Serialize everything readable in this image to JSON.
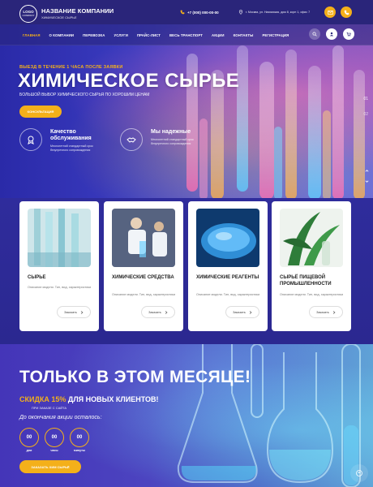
{
  "header": {
    "logo_line1": "LOGO",
    "logo_line2": "COMPANY",
    "company_name": "НАЗВАНИЕ КОМПАНИИ",
    "company_sub": "ХИМИЧЕСКОЕ СЫРЬЕ",
    "phone": "+7 (000) 000-00-00",
    "address": "г. Москва, ул. Нахимская, дом 8, корп 1, офис 7",
    "icons": [
      "phone-icon",
      "map-pin-icon",
      "mail-icon",
      "call-icon"
    ]
  },
  "nav": {
    "items": [
      {
        "label": "ГЛАВНАЯ",
        "active": true
      },
      {
        "label": "О КОМПАНИИ"
      },
      {
        "label": "ПЕРЕВОЗКА"
      },
      {
        "label": "УСЛУГИ"
      },
      {
        "label": "ПРАЙС-ЛИСТ"
      },
      {
        "label": "ВЕСЬ ТРАНСПОРТ"
      },
      {
        "label": "АКЦИИ"
      },
      {
        "label": "КОНТАКТЫ"
      },
      {
        "label": "РЕГИСТРАЦИЯ"
      }
    ],
    "icons": [
      "search-icon",
      "user-icon",
      "cart-icon"
    ]
  },
  "hero": {
    "tagline": "ВЫЕЗД В ТЕЧЕНИЕ 1 ЧАСА ПОСЛЕ ЗАЯВКИ",
    "title": "ХИМИЧЕСКОЕ СЫРЬЕ",
    "subtitle": "БОЛЬШОЙ ВЫБОР ХИМИЧЕСКОГО СЫРЬЯ ПО ХОРОШИМ ЦЕНАМ",
    "button": "КОНСУЛЬТАЦИЯ",
    "features": [
      {
        "title": "Качество обслуживания",
        "desc": "Многолетний стандартный срок безупречного сопровождения",
        "icon": "award-icon"
      },
      {
        "title": "Мы надежные",
        "desc": "Многолетний стандартный срок безупречного сопровождения",
        "icon": "handshake-icon"
      }
    ],
    "slides": [
      "01",
      "02"
    ]
  },
  "cards": [
    {
      "title": "СЫРЬЕ",
      "desc": "Описание модели. Тип, вид, характеристики",
      "button": "Заказать"
    },
    {
      "title": "ХИМИЧЕСКИЕ СРЕДСТВА",
      "desc": "Описание модели. Тип, вид, характеристики",
      "button": "Заказать"
    },
    {
      "title": "ХИМИЧЕСКИЕ РЕАГЕНТЫ",
      "desc": "Описание модели. Тип, вид, характеристики",
      "button": "Заказать"
    },
    {
      "title": "СЫРЬЁ ПИЩЕВОЙ ПРОМЫШЛЕННОСТИ",
      "desc": "Описание модели. Тип, вид, характеристики",
      "button": "Заказать"
    }
  ],
  "promo": {
    "title": "ТОЛЬКО В ЭТОМ МЕСЯЦЕ!",
    "discount_highlight": "СКИДКА 15%",
    "discount_rest": "ДЛЯ НОВЫХ КЛИЕНТОВ!",
    "small": "ПРИ ЗАКАЗЕ С САЙТА",
    "left_label": "До окончания акции осталось:",
    "timer": [
      {
        "value": "00",
        "label": "дни"
      },
      {
        "value": "00",
        "label": "часы"
      },
      {
        "value": "00",
        "label": "минуты"
      }
    ],
    "button": "ЗАКАЗАТЬ ХИМ СЫРЬЁ"
  },
  "colors": {
    "accent": "#f4b01a",
    "primary": "#2a257a"
  }
}
